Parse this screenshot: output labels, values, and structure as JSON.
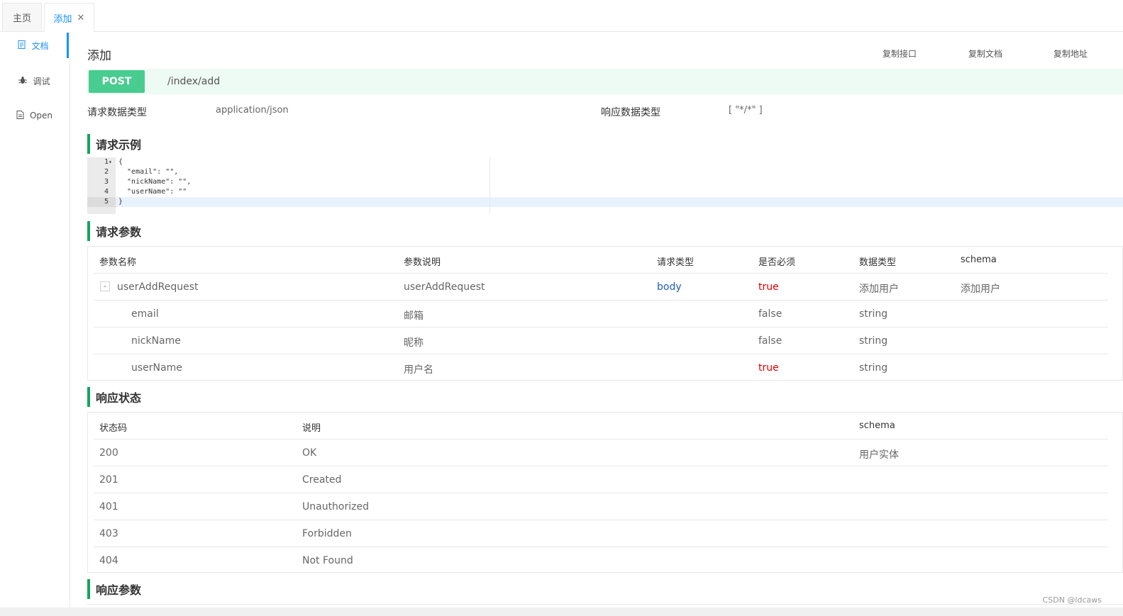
{
  "tabs": {
    "home": "主页",
    "active": "添加",
    "close_glyph": "✕"
  },
  "sidebar": {
    "items": [
      {
        "label": "文档",
        "icon": "document-icon",
        "active": true
      },
      {
        "label": "调试",
        "icon": "bug-icon",
        "active": false
      },
      {
        "label": "Open",
        "icon": "file-icon",
        "active": false
      }
    ]
  },
  "page": {
    "title": "添加",
    "copy_interface": "复制接口",
    "copy_doc": "复制文档",
    "copy_url": "复制地址"
  },
  "endpoint": {
    "method": "POST",
    "path": "/index/add",
    "method_color": "#49cc90"
  },
  "meta": {
    "request_type_label": "请求数据类型",
    "request_type_value": "application/json",
    "response_type_label": "响应数据类型",
    "response_type_value": "[ \"*/*\" ]"
  },
  "request_example": {
    "title": "请求示例",
    "lines": [
      "{",
      "  \"email\": \"\",",
      "  \"nickName\": \"\",",
      "  \"userName\": \"\"",
      "}"
    ],
    "line_numbers": [
      "1",
      "2",
      "3",
      "4",
      "5"
    ]
  },
  "request_params": {
    "title": "请求参数",
    "headers": [
      "参数名称",
      "参数说明",
      "请求类型",
      "是否必须",
      "数据类型",
      "schema"
    ],
    "rows": [
      {
        "name": "userAddRequest",
        "desc": "userAddRequest",
        "in": "body",
        "required": "true",
        "type": "添加用户",
        "schema": "添加用户",
        "expander": "-"
      },
      {
        "name": "email",
        "desc": "邮箱",
        "in": "",
        "required": "false",
        "type": "string",
        "schema": ""
      },
      {
        "name": "nickName",
        "desc": "昵称",
        "in": "",
        "required": "false",
        "type": "string",
        "schema": ""
      },
      {
        "name": "userName",
        "desc": "用户名",
        "in": "",
        "required": "true",
        "type": "string",
        "schema": ""
      }
    ]
  },
  "response_status": {
    "title": "响应状态",
    "headers": [
      "状态码",
      "说明",
      "schema"
    ],
    "rows": [
      {
        "code": "200",
        "desc": "OK",
        "schema": "用户实体"
      },
      {
        "code": "201",
        "desc": "Created",
        "schema": ""
      },
      {
        "code": "401",
        "desc": "Unauthorized",
        "schema": ""
      },
      {
        "code": "403",
        "desc": "Forbidden",
        "schema": ""
      },
      {
        "code": "404",
        "desc": "Not Found",
        "schema": ""
      }
    ]
  },
  "response_params": {
    "title": "响应参数"
  },
  "watermark": "CSDN @ldcaws",
  "colors": {
    "accent": "#1890ff",
    "section_bar": "#16a35f",
    "required_true": "#e00000",
    "body_param": "#1e5fb4"
  }
}
